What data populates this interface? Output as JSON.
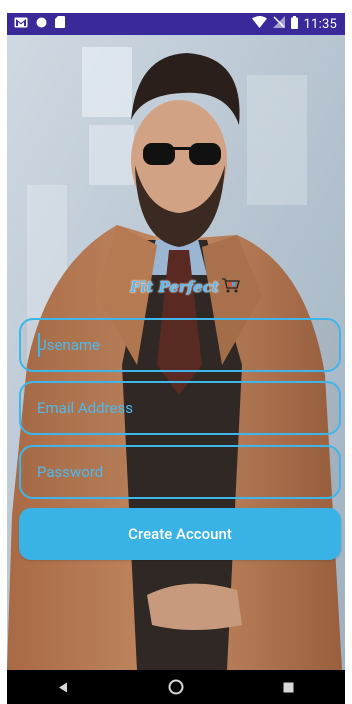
{
  "status_bar": {
    "time": "11:35",
    "left_icons": [
      "gmail-icon",
      "circle-app-icon",
      "sd-card-icon"
    ],
    "right_icons": [
      "wifi-icon",
      "no-signal-icon",
      "battery-icon"
    ]
  },
  "logo": {
    "text": "Fit Perfect"
  },
  "form": {
    "username": {
      "value": "",
      "placeholder": "Usename"
    },
    "email": {
      "value": "",
      "placeholder": "Email Address"
    },
    "password": {
      "value": "",
      "placeholder": "Password"
    },
    "submit_label": "Create Account"
  },
  "nav_bar": {
    "buttons": [
      "back-icon",
      "home-icon",
      "recents-icon"
    ]
  },
  "colors": {
    "accent": "#39b2e6",
    "status_bar": "#3a2a99",
    "logo_text": "#5fb8ee"
  }
}
